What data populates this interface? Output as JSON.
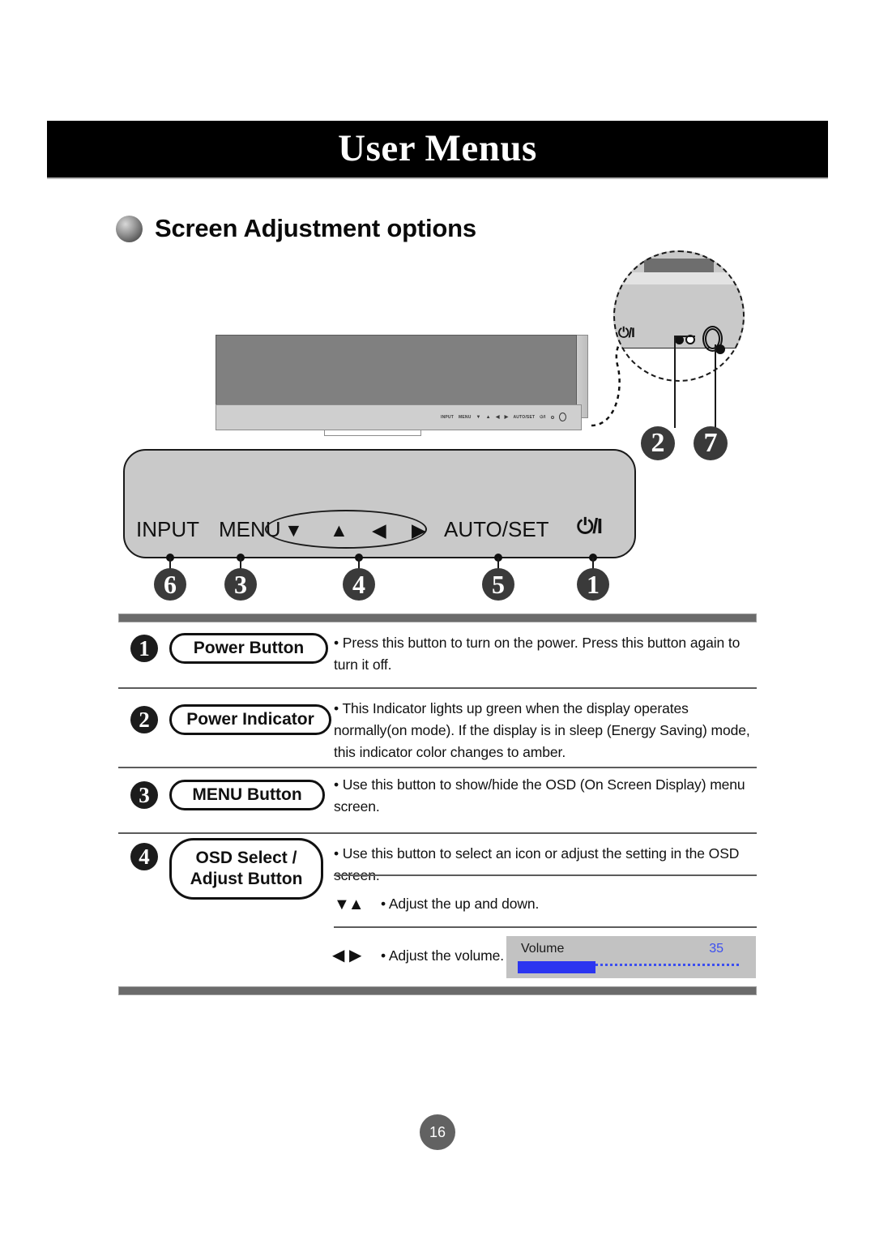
{
  "banner": {
    "title": "User Menus"
  },
  "section": {
    "title": "Screen Adjustment options",
    "bullet_icon": "sphere-bullet-icon"
  },
  "monitor": {
    "bezel_controls": [
      "INPUT",
      "MENU",
      "▼",
      "▲",
      "◀",
      "▶",
      "AUTO/SET",
      "⏻/I"
    ],
    "power_symbol": "⏻/I"
  },
  "callout": {
    "power_symbol": "⏻/I",
    "badges": [
      {
        "number": "②",
        "label": "2"
      },
      {
        "number": "⑦",
        "label": "7"
      }
    ]
  },
  "panel": {
    "labels": [
      "INPUT",
      "MENU",
      "AUTO/SET"
    ],
    "power_symbol": "⏻/I",
    "arrows": [
      "▼",
      "▲",
      "◀",
      "▶"
    ],
    "badges": [
      "6",
      "3",
      "4",
      "5",
      "1"
    ]
  },
  "table": {
    "rows": [
      {
        "num": "1",
        "pill": [
          "Power Button"
        ],
        "desc": "• Press this button to turn on the power. Press this button again to turn it off."
      },
      {
        "num": "2",
        "pill": [
          "Power Indicator"
        ],
        "desc": "• This Indicator lights up green when the display operates normally(on mode). If the display is in sleep (Energy Saving) mode, this indicator color changes to amber."
      },
      {
        "num": "3",
        "pill": [
          "MENU Button"
        ],
        "desc": "• Use this button to show/hide the OSD (On Screen Display) menu screen."
      },
      {
        "num": "4",
        "pill": [
          "OSD Select /",
          "Adjust Button"
        ],
        "desc": "•  Use this button to select an icon or adjust the setting in the OSD screen.",
        "sub": [
          {
            "glyphs": "▼▲",
            "text": "• Adjust the up and down."
          },
          {
            "glyphs": "◀ ▶",
            "text": "• Adjust the volume."
          }
        ]
      }
    ]
  },
  "volume_osd": {
    "label": "Volume",
    "value": "35",
    "fill_percent": 35,
    "fill_color": "#2b35f0",
    "track_color": "#3b4ef0",
    "background": "#c2c2c2"
  },
  "footer": {
    "page_number": "16"
  }
}
